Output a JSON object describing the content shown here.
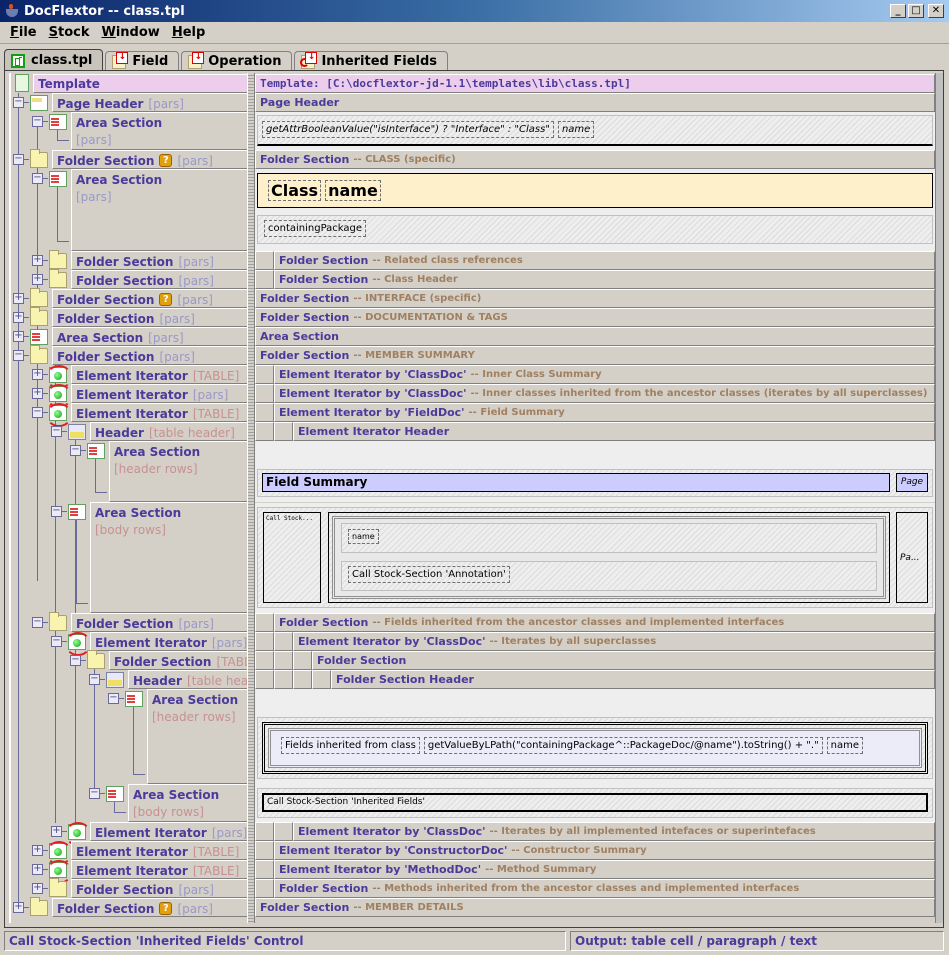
{
  "window": {
    "title": "DocFlextor -- class.tpl",
    "controls": {
      "minimize": "_",
      "maximize": "□",
      "close": "✕"
    }
  },
  "menu": [
    {
      "label": "File",
      "mnemonic": "F"
    },
    {
      "label": "Stock",
      "mnemonic": "S"
    },
    {
      "label": "Window",
      "mnemonic": "W"
    },
    {
      "label": "Help",
      "mnemonic": "H"
    }
  ],
  "tabs": [
    {
      "label": "class.tpl",
      "icon": "template-icon",
      "active": true
    },
    {
      "label": "Field",
      "icon": "stock-section-icon",
      "active": false
    },
    {
      "label": "Operation",
      "icon": "stock-section-icon",
      "active": false
    },
    {
      "label": "Inherited Fields",
      "icon": "stock-inherited-icon",
      "active": false
    }
  ],
  "tree": {
    "root": "Template",
    "nodes": [
      {
        "label": "Page Header",
        "attr": "[pars]"
      },
      {
        "label": "Area Section",
        "attr": "[pars]"
      },
      {
        "label": "Folder Section",
        "attr": "[pars]",
        "question": true
      },
      {
        "label": "Area Section",
        "attr": "[pars]"
      },
      {
        "label": "Folder Section",
        "attr": "[pars]"
      },
      {
        "label": "Folder Section",
        "attr": "[pars]"
      },
      {
        "label": "Folder Section",
        "attr": "[pars]",
        "question": true
      },
      {
        "label": "Folder Section",
        "attr": "[pars]"
      },
      {
        "label": "Area Section",
        "attr": "[pars]"
      },
      {
        "label": "Folder Section",
        "attr": "[pars]"
      },
      {
        "label": "Element Iterator",
        "attr": "[TABLE]"
      },
      {
        "label": "Element Iterator",
        "attr": "[pars]"
      },
      {
        "label": "Element Iterator",
        "attr": "[TABLE]"
      },
      {
        "label": "Header",
        "attr": "[table header]"
      },
      {
        "label": "Area Section",
        "attr": "[header rows]"
      },
      {
        "label": "Area Section",
        "attr": "[body rows]"
      },
      {
        "label": "Folder Section",
        "attr": "[pars]"
      },
      {
        "label": "Element Iterator",
        "attr": "[pars]"
      },
      {
        "label": "Folder Section",
        "attr": "[TABLE]"
      },
      {
        "label": "Header",
        "attr": "[table header]"
      },
      {
        "label": "Area Section",
        "attr": "[header rows]"
      },
      {
        "label": "Area Section",
        "attr": "[body rows]"
      },
      {
        "label": "Element Iterator",
        "attr": "[pars]"
      },
      {
        "label": "Element Iterator",
        "attr": "[TABLE]"
      },
      {
        "label": "Element Iterator",
        "attr": "[TABLE]"
      },
      {
        "label": "Folder Section",
        "attr": "[pars]"
      },
      {
        "label": "Folder Section",
        "attr": "[pars]",
        "question": true
      }
    ]
  },
  "editor": {
    "template_header": "Template:  [C:\\docflextor-jd-1.1\\templates\\lib\\class.tpl]",
    "rows": [
      {
        "title": "Page Header",
        "desc": ""
      },
      {
        "title": "Folder Section",
        "desc": "-- CLASS (specific)"
      },
      {
        "title": "Folder Section",
        "desc": "-- Related class references"
      },
      {
        "title": "Folder Section",
        "desc": "-- Class Header"
      },
      {
        "title": "Folder Section",
        "desc": "-- INTERFACE (specific)"
      },
      {
        "title": "Folder Section",
        "desc": "-- DOCUMENTATION & TAGS"
      },
      {
        "title": "Area Section",
        "desc": ""
      },
      {
        "title": "Folder Section",
        "desc": "-- MEMBER SUMMARY"
      },
      {
        "title": "Element Iterator by 'ClassDoc'",
        "desc": "-- Inner Class Summary"
      },
      {
        "title": "Element Iterator by 'ClassDoc'",
        "desc": "-- Inner classes inherited from the ancestor classes (iterates by all superclasses)"
      },
      {
        "title": "Element Iterator by 'FieldDoc'",
        "desc": "-- Field Summary"
      },
      {
        "title": "Element Iterator Header",
        "desc": ""
      },
      {
        "title": "Folder Section",
        "desc": "-- Fields inherited from the ancestor classes and implemented interfaces"
      },
      {
        "title": "Element Iterator by 'ClassDoc'",
        "desc": "-- Iterates by all superclasses"
      },
      {
        "title": "Folder Section",
        "desc": ""
      },
      {
        "title": "Folder Section Header",
        "desc": ""
      },
      {
        "title": "Element Iterator by 'ClassDoc'",
        "desc": "-- Iterates by all implemented intefaces or superintefaces"
      },
      {
        "title": "Element Iterator by 'ConstructorDoc'",
        "desc": "-- Constructor Summary"
      },
      {
        "title": "Element Iterator by 'MethodDoc'",
        "desc": "-- Method Summary"
      },
      {
        "title": "Folder Section",
        "desc": "-- Methods inherited from the ancestor classes and implemented interfaces"
      },
      {
        "title": "Folder Section",
        "desc": "-- MEMBER DETAILS"
      }
    ],
    "page_header_fields": [
      "getAttrBooleanValue(\"isInterface\") ? \"Interface\" : \"Class\"",
      "name"
    ],
    "class_fields": [
      "Class",
      "name"
    ],
    "containing_package": "containingPackage",
    "field_summary": {
      "title": "Field Summary",
      "page": "Page",
      "call_stock": "Call Stock...",
      "name": "name",
      "annotation": "Call Stock-Section 'Annotation'",
      "page_short": "Pa..."
    },
    "inherited": {
      "label": "Fields inherited from class",
      "expr": "getValueByLPath(\"containingPackage^::PackageDoc/@name\").toString() + \".\"",
      "name": "name",
      "call": "Call Stock-Section 'Inherited Fields'"
    }
  },
  "status": {
    "left": "Call Stock-Section 'Inherited Fields' Control",
    "right": "Output:  table cell / paragraph / text"
  },
  "colors": {
    "label": "#4a3a9a",
    "desc": "#a08060",
    "template_bg": "#eccdec",
    "class_bg": "#fff0cc",
    "summary_bg": "#ccccff"
  }
}
